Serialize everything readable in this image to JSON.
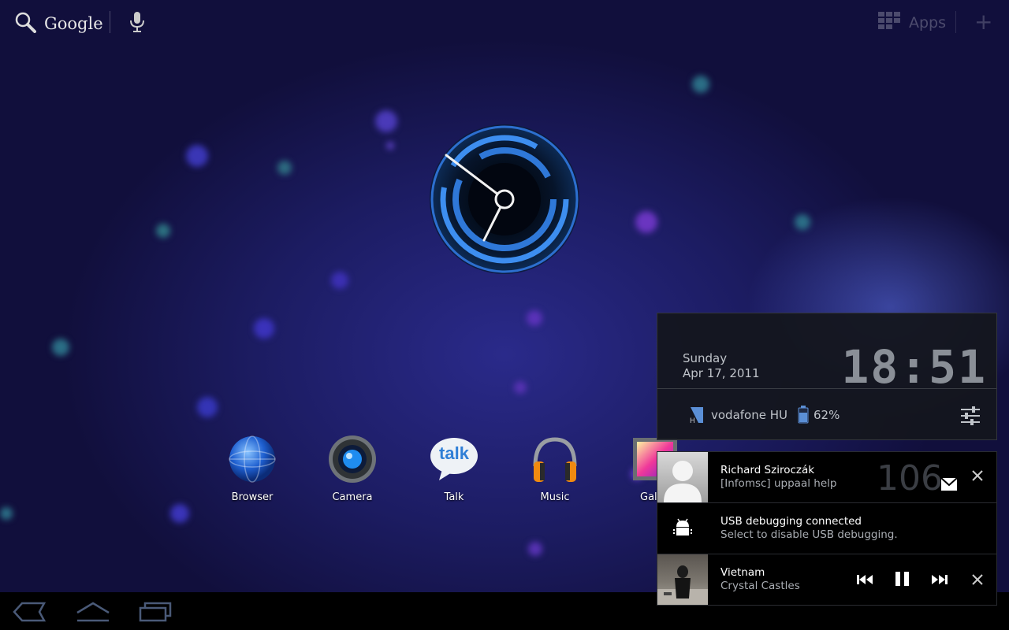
{
  "top_bar": {
    "search_label": "Google",
    "apps_label": "Apps"
  },
  "dock": [
    {
      "label": "Browser"
    },
    {
      "label": "Camera"
    },
    {
      "label": "Talk"
    },
    {
      "label": "Music"
    },
    {
      "label": "Gall"
    }
  ],
  "talk_icon_text": "talk",
  "notification_panel": {
    "day": "Sunday",
    "date": "Apr 17, 2011",
    "time": "18:51",
    "carrier": "vodafone HU",
    "battery": "62%",
    "notifications": [
      {
        "title": "Richard Sziroczák",
        "subtitle": "[Infomsc] uppaal help",
        "count": "106"
      },
      {
        "title": "USB debugging connected",
        "subtitle": "Select to disable USB debugging."
      },
      {
        "title": "Vietnam",
        "subtitle": "Crystal Castles"
      }
    ]
  },
  "colors": {
    "clock_accent": "#3d8ef0",
    "nav_bg": "#000000",
    "panel_bg": "#14161e"
  }
}
